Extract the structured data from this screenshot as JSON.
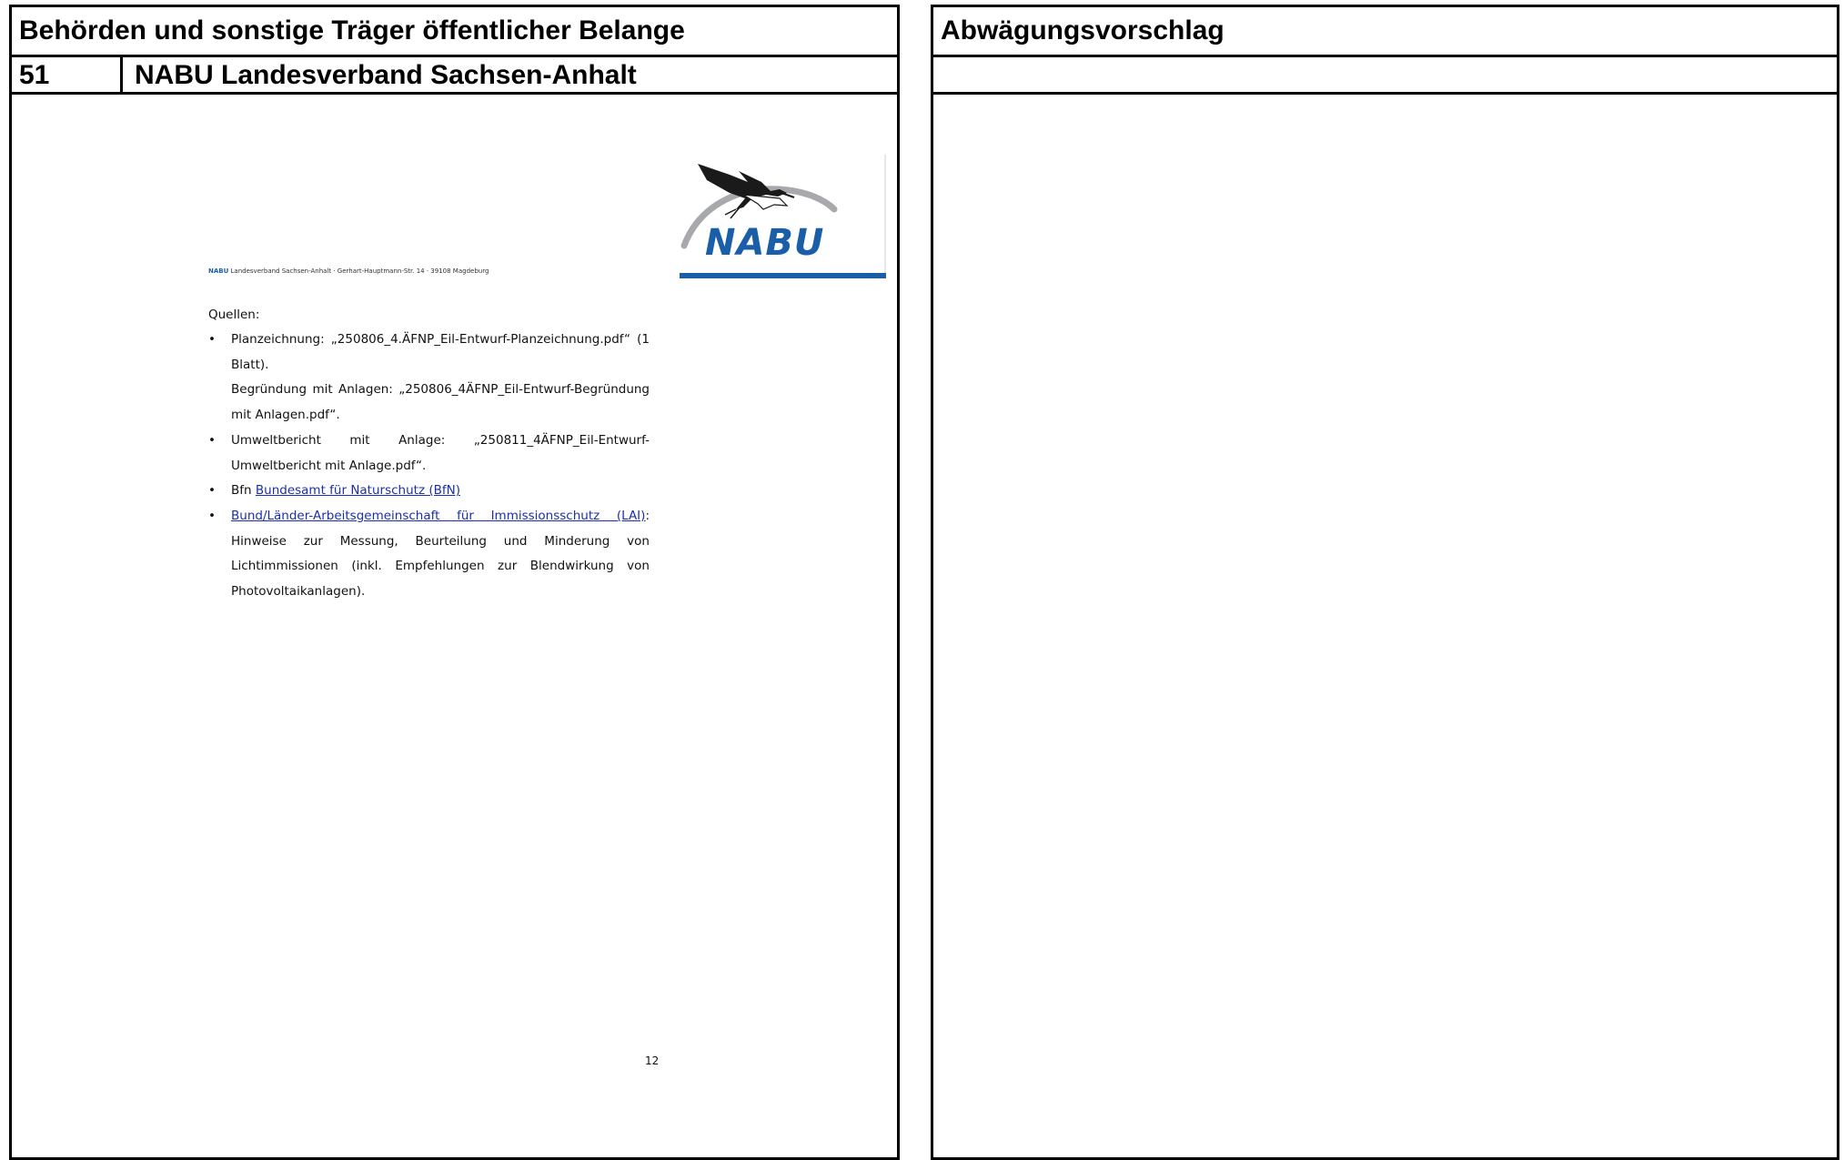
{
  "left": {
    "title": "Behörden und sonstige Träger öffentlicher Belange",
    "number": "51",
    "organization": "NABU Landesverband Sachsen-Anhalt"
  },
  "right": {
    "title": "Abwägungsvorschlag"
  },
  "letter": {
    "logo_text": "NABU",
    "sender_org": "NABU",
    "sender_rest": " Landesverband Sachsen-Anhalt · Gerhart-Hauptmann-Str. 14 · 39108 Magdeburg",
    "heading": "Quellen:",
    "sources": {
      "item1": "Planzeichnung:   „250806_4.ÄFNP_Eil-Entwurf-Planzeichnung.pdf“  (1 Blatt).",
      "item1b": "Begründung mit Anlagen: „250806_4ÄFNP_Eil-Entwurf-Begründung mit Anlagen.pdf“.",
      "item2": "Umweltbericht mit Anlage: „250811_4ÄFNP_Eil-Entwurf-Umweltbericht mit Anlage.pdf“.",
      "item3_prefix": "Bfn ",
      "item3_link": "Bundesamt für Naturschutz (BfN)",
      "item4_link": "Bund/Länder-Arbeitsgemeinschaft für Immissionsschutz (LAI)",
      "item4_rest": ": Hinweise zur Messung, Beurteilung und Minderung von Lichtimmissionen (inkl. Empfehlungen zur Blendwirkung von Photovoltaikanlagen)."
    },
    "page_number": "12"
  },
  "colors": {
    "nabu_blue": "#1b5ea8",
    "link_blue": "#1a2fb0",
    "arc_gray": "#a7a9ac"
  }
}
